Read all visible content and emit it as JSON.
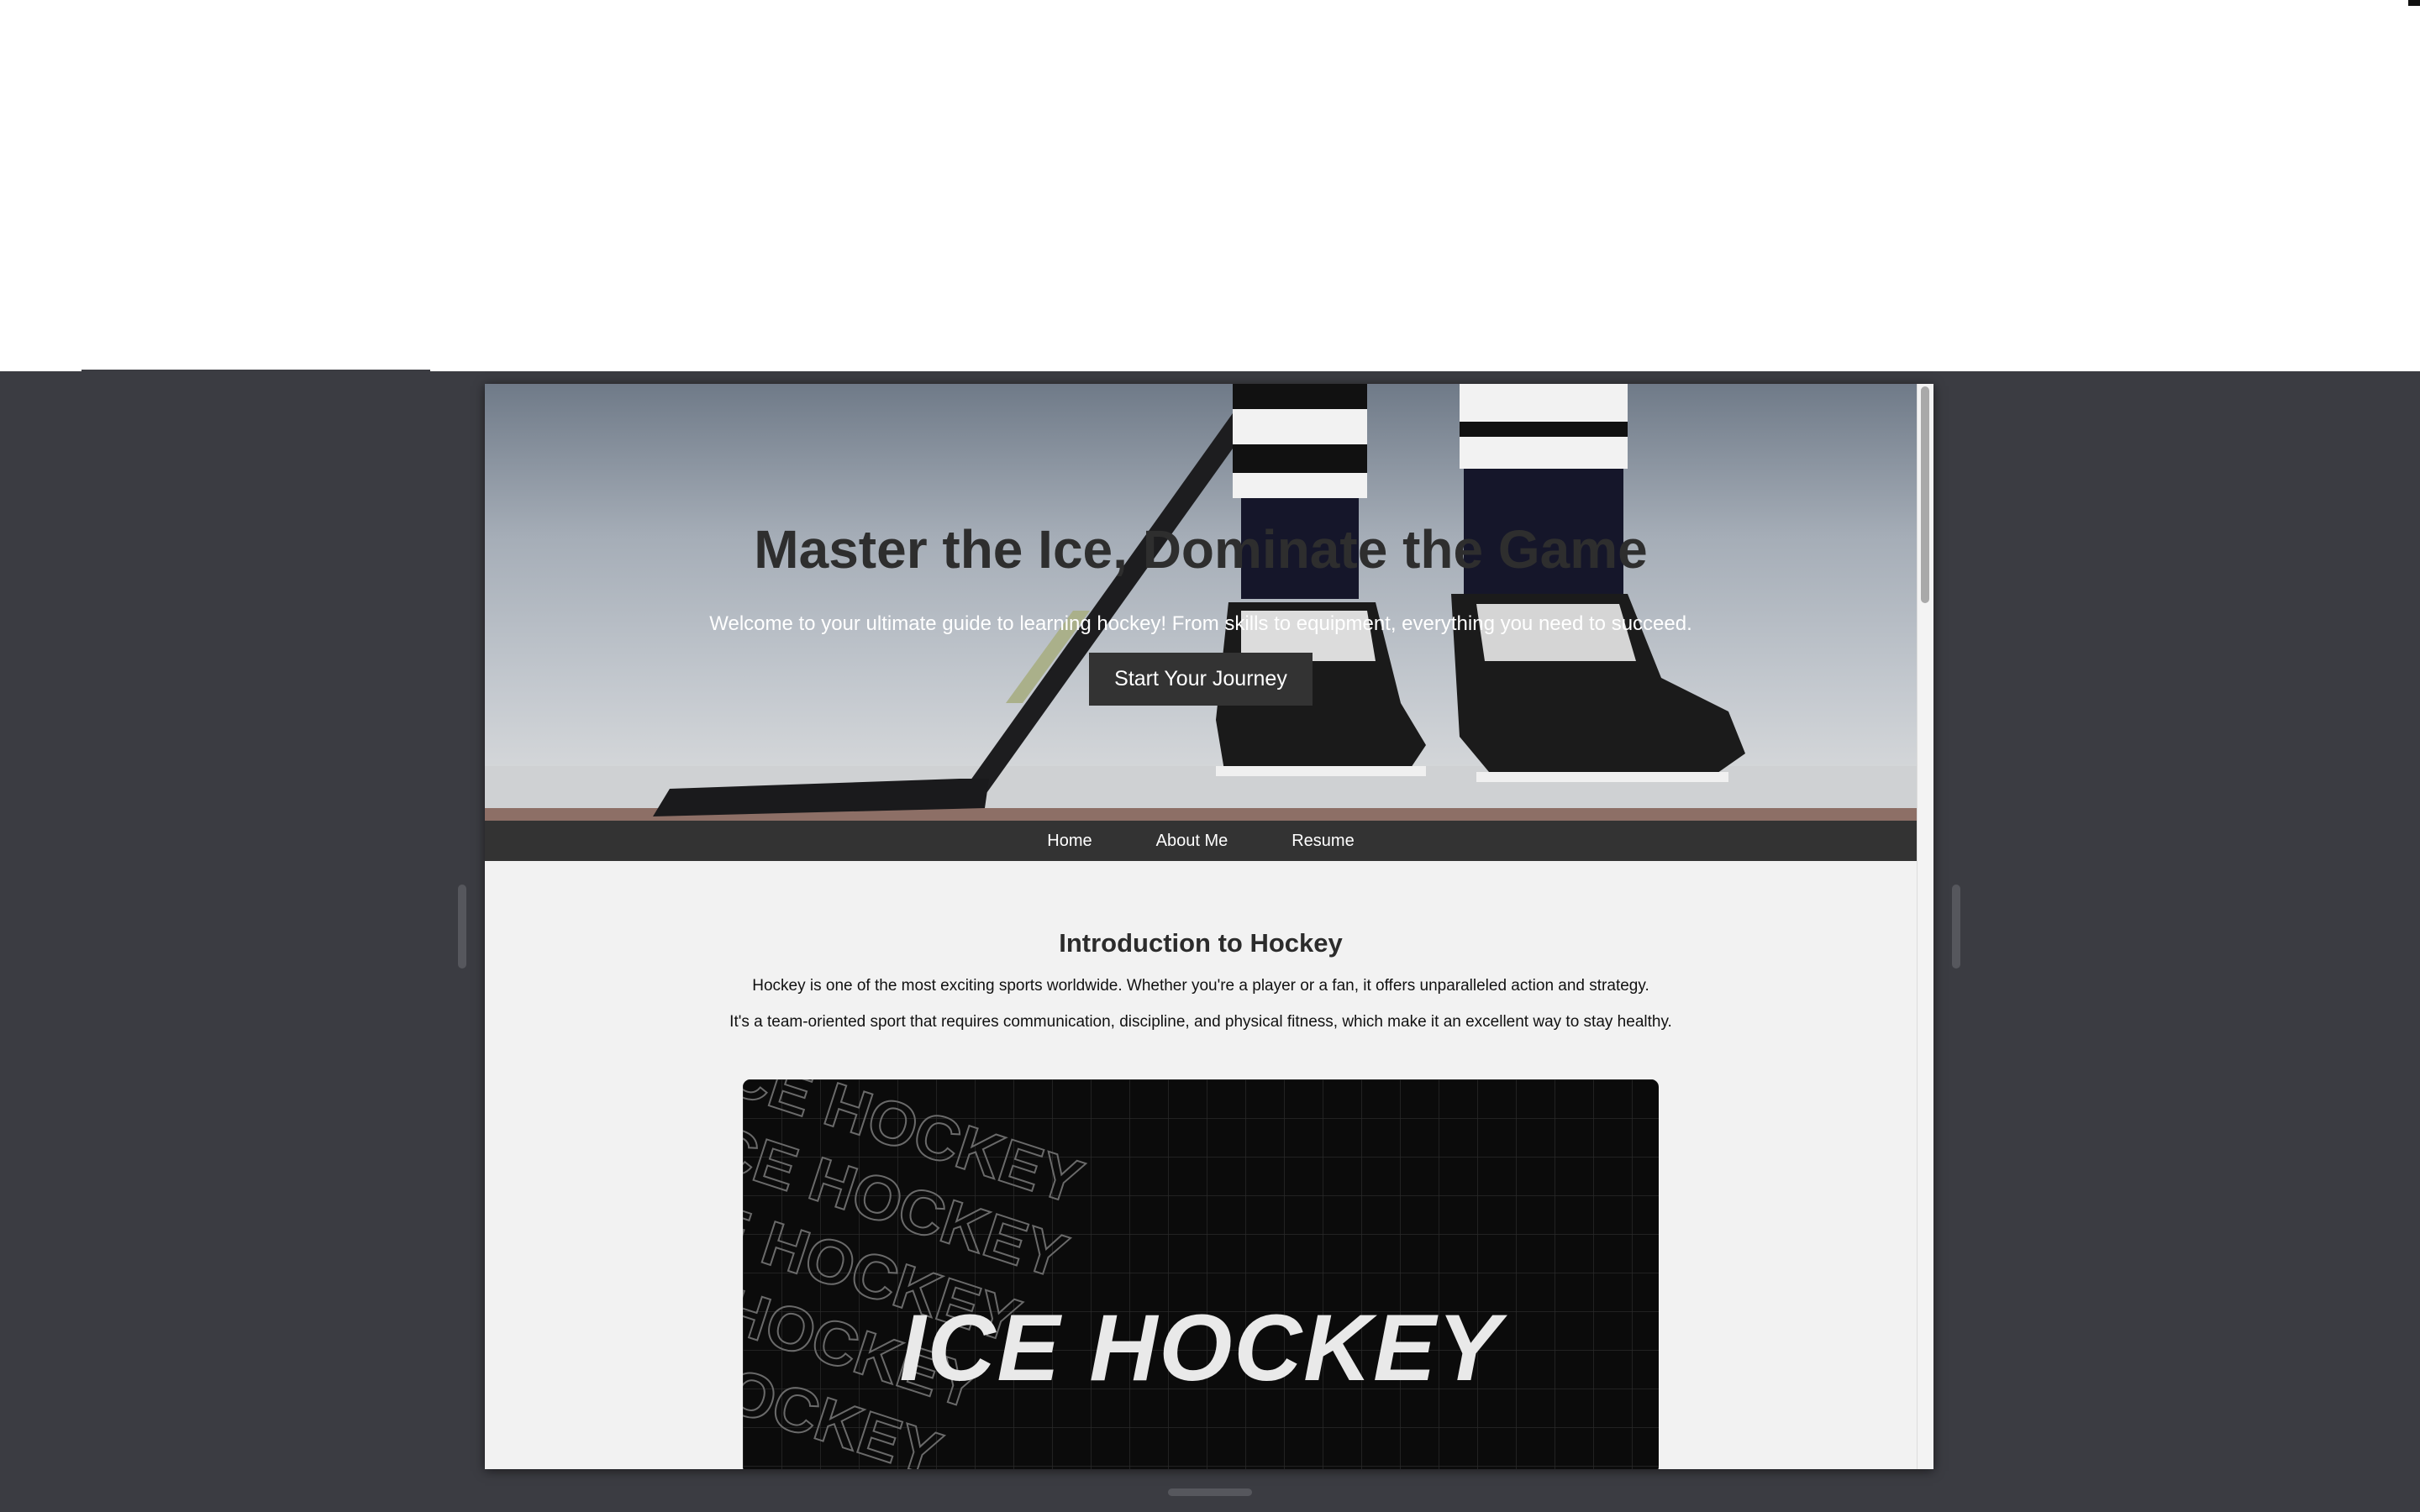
{
  "hero": {
    "title": "Master the Ice, Dominate the Game",
    "subtitle": "Welcome to your ultimate guide to learning hockey! From skills to equipment, everything you need to succeed.",
    "cta_label": "Start Your Journey"
  },
  "nav": {
    "items": [
      {
        "label": "Home"
      },
      {
        "label": "About Me"
      },
      {
        "label": "Resume"
      }
    ]
  },
  "intro": {
    "title": "Introduction to Hockey",
    "paragraphs": [
      "Hockey is one of the most exciting sports worldwide. Whether you're a player or a fan, it offers unparalleled action and strategy.",
      "It's a team-oriented sport that requires communication, discipline, and physical fitness, which make it an excellent way to stay healthy."
    ]
  },
  "banner": {
    "text": "ICE HOCKEY",
    "pattern_text": "ICE HOCKEY"
  },
  "colors": {
    "backdrop": "#3b3c42",
    "page_bg": "#f2f2f2",
    "nav_bg": "#333333",
    "button_bg": "#333333"
  }
}
